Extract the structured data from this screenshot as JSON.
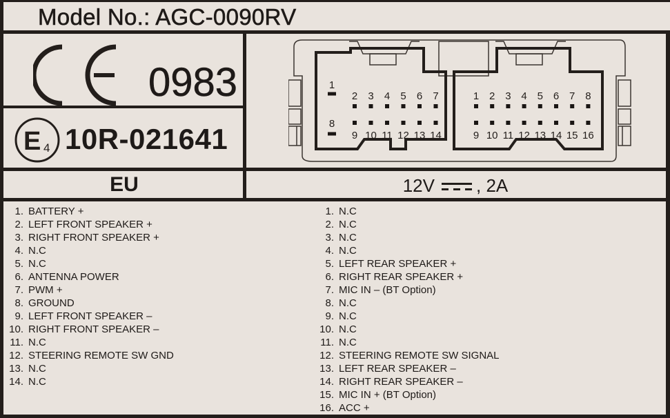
{
  "model": {
    "label": "Model No.: AGC-0090RV"
  },
  "ce_mark": {
    "symbol": "CE",
    "notified_body": "0983"
  },
  "e_mark": {
    "circle_letter": "E",
    "country_code": "4",
    "approval": "10R-021641"
  },
  "region": "EU",
  "power_rating": {
    "voltage": "12V",
    "current": "2A",
    "separator": ",",
    "dc_symbol": "dc-current-icon"
  },
  "connector_a": {
    "top_numbers": [
      "1",
      "2",
      "3",
      "4",
      "5",
      "6",
      "7"
    ],
    "bottom_numbers": [
      "8",
      "9",
      "10",
      "11",
      "12",
      "13",
      "14"
    ]
  },
  "connector_b": {
    "top_numbers": [
      "1",
      "2",
      "3",
      "4",
      "5",
      "6",
      "7",
      "8"
    ],
    "bottom_numbers": [
      "9",
      "10",
      "11",
      "12",
      "13",
      "14",
      "15",
      "16"
    ]
  },
  "pins_left": [
    {
      "num": "1.",
      "label": "BATTERY +"
    },
    {
      "num": "2.",
      "label": "LEFT FRONT SPEAKER +"
    },
    {
      "num": "3.",
      "label": "RIGHT FRONT SPEAKER +"
    },
    {
      "num": "4.",
      "label": "N.C"
    },
    {
      "num": "5.",
      "label": "N.C"
    },
    {
      "num": "6.",
      "label": "ANTENNA POWER"
    },
    {
      "num": "7.",
      "label": "PWM +"
    },
    {
      "num": "8.",
      "label": "GROUND"
    },
    {
      "num": "9.",
      "label": "LEFT FRONT SPEAKER –"
    },
    {
      "num": "10.",
      "label": "RIGHT FRONT SPEAKER –"
    },
    {
      "num": "11.",
      "label": "N.C"
    },
    {
      "num": "12.",
      "label": "STEERING REMOTE SW GND"
    },
    {
      "num": "13.",
      "label": "N.C"
    },
    {
      "num": "14.",
      "label": "N.C"
    }
  ],
  "pins_right": [
    {
      "num": "1.",
      "label": "N.C"
    },
    {
      "num": "2.",
      "label": "N.C"
    },
    {
      "num": "3.",
      "label": "N.C"
    },
    {
      "num": "4.",
      "label": "N.C"
    },
    {
      "num": "5.",
      "label": "LEFT REAR SPEAKER +"
    },
    {
      "num": "6.",
      "label": "RIGHT REAR SPEAKER +"
    },
    {
      "num": "7.",
      "label": "MIC IN – (BT Option)"
    },
    {
      "num": "8.",
      "label": "N.C"
    },
    {
      "num": "9.",
      "label": "N.C"
    },
    {
      "num": "10.",
      "label": "N.C"
    },
    {
      "num": "11.",
      "label": "N.C"
    },
    {
      "num": "12.",
      "label": "STEERING REMOTE SW SIGNAL"
    },
    {
      "num": "13.",
      "label": "LEFT REAR SPEAKER –"
    },
    {
      "num": "14.",
      "label": "RIGHT REAR SPEAKER –"
    },
    {
      "num": "15.",
      "label": "MIC IN + (BT Option)"
    },
    {
      "num": "16.",
      "label": "ACC +"
    }
  ]
}
